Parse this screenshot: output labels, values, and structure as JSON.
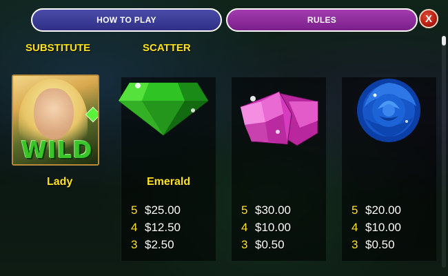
{
  "tabs": {
    "how_to_play": "HOW TO PLAY",
    "rules": "RULES",
    "close": "X"
  },
  "labels": {
    "substitute": "SUBSTITUTE",
    "scatter": "SCATTER"
  },
  "wild_card": {
    "wild_text": "WILD"
  },
  "symbols": [
    {
      "name": "Lady"
    },
    {
      "name": "Emerald"
    }
  ],
  "paytables": [
    {
      "rows": [
        {
          "count": "5",
          "amount": "$25.00"
        },
        {
          "count": "4",
          "amount": "$12.50"
        },
        {
          "count": "3",
          "amount": "$2.50"
        }
      ]
    },
    {
      "rows": [
        {
          "count": "5",
          "amount": "$30.00"
        },
        {
          "count": "4",
          "amount": "$10.00"
        },
        {
          "count": "3",
          "amount": "$0.50"
        }
      ]
    },
    {
      "rows": [
        {
          "count": "5",
          "amount": "$20.00"
        },
        {
          "count": "4",
          "amount": "$10.00"
        },
        {
          "count": "3",
          "amount": "$0.50"
        }
      ]
    }
  ],
  "colors": {
    "label_yellow": "#ffe41a",
    "how_to_play_tab": "#3b3d96",
    "rules_tab": "#8e2b9e",
    "close_button": "#c62616"
  },
  "icons": [
    "wild-lady-icon",
    "emerald-icon",
    "pink-diamond-icon",
    "blue-rose-icon",
    "close-icon"
  ]
}
